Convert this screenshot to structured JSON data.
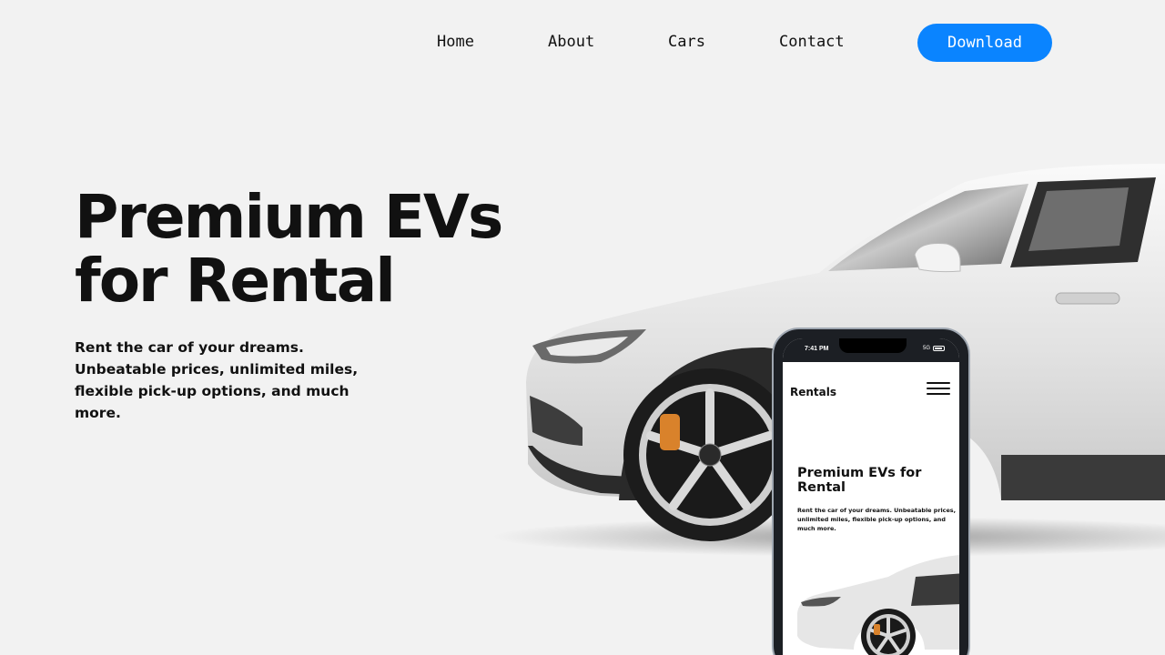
{
  "nav": {
    "links": [
      "Home",
      "About",
      "Cars",
      "Contact"
    ],
    "download_label": "Download"
  },
  "hero": {
    "title": "Premium EVs for Rental",
    "subtitle": "Rent the car of your dreams. Unbeatable prices, unlimited miles, flexible pick-up options, and much more."
  },
  "phone": {
    "status_time": "7:41 PM",
    "status_network": "5G",
    "brand": "Rentals",
    "title": "Premium EVs for Rental",
    "subtitle": "Rent the car of your dreams. Unbeatable prices, unlimited miles, flexible pick-up options, and much more."
  },
  "colors": {
    "accent": "#0a84ff",
    "background": "#f2f2f2",
    "text": "#111111"
  },
  "icons": [
    "hamburger-menu-icon",
    "battery-icon"
  ]
}
